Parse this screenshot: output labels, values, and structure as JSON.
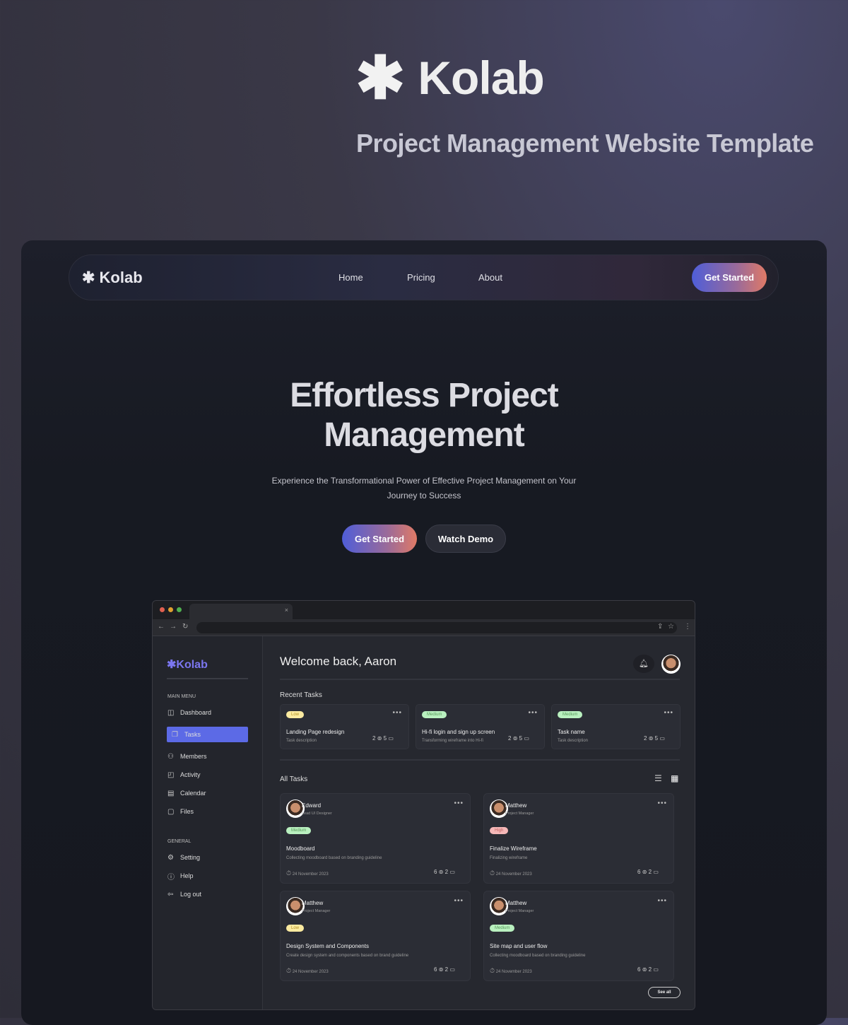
{
  "brand": {
    "name": "Kolab",
    "tagline": "Project Management Website Template"
  },
  "nav": {
    "logo": "Kolab",
    "links": [
      "Home",
      "Pricing",
      "About"
    ],
    "cta": "Get Started"
  },
  "hero": {
    "title_line1": "Effortless Project",
    "title_line2": "Management",
    "subtitle_line1": "Experience the Transformational Power of Effective Project Management on Your",
    "subtitle_line2": "Journey to Success",
    "primary": "Get Started",
    "secondary": "Watch Demo"
  },
  "browser": {
    "tab_close": "×"
  },
  "app": {
    "logo": "Kolab",
    "main_menu_label": "MAIN MENU",
    "main_menu": [
      {
        "label": "Dashboard",
        "icon": "dashboard-icon"
      },
      {
        "label": "Tasks",
        "icon": "tasks-icon",
        "active": true
      },
      {
        "label": "Members",
        "icon": "members-icon"
      },
      {
        "label": "Activity",
        "icon": "activity-icon"
      },
      {
        "label": "Calendar",
        "icon": "calendar-icon"
      },
      {
        "label": "Files",
        "icon": "files-icon"
      }
    ],
    "general_label": "GENERAL",
    "general": [
      {
        "label": "Setting",
        "icon": "gear-icon"
      },
      {
        "label": "Help",
        "icon": "help-icon"
      },
      {
        "label": "Log out",
        "icon": "logout-icon"
      }
    ],
    "welcome": "Welcome back, Aaron",
    "recent_title": "Recent Tasks",
    "recent": [
      {
        "priority": "Low",
        "title": "Landing Page redesign",
        "desc": "Task description",
        "attachments": "2",
        "comments": "5"
      },
      {
        "priority": "Medium",
        "title": "Hi-fi login and sign up screen",
        "desc": "Transforming wireframe into Hi-fi",
        "attachments": "2",
        "comments": "5"
      },
      {
        "priority": "Medium",
        "title": "Task name",
        "desc": "Task description",
        "attachments": "2",
        "comments": "5"
      }
    ],
    "all_title": "All Tasks",
    "all": [
      {
        "name": "Edward",
        "role": "Lead UI Designer",
        "priority": "Medium",
        "title": "Moodboard",
        "desc": "Collecting moodboard based on branding guideline",
        "date": "24 November 2023",
        "attachments": "6",
        "comments": "2"
      },
      {
        "name": "Matthew",
        "role": "Project Manager",
        "priority": "High",
        "title": "Finalize Wireframe",
        "desc": "Finalizing wireframe",
        "date": "24 November 2023",
        "attachments": "6",
        "comments": "2"
      },
      {
        "name": "Matthew",
        "role": "Project Manager",
        "priority": "Low",
        "title": "Design System and Components",
        "desc": "Create design system and components based on brand guideline",
        "date": "24 November 2023",
        "attachments": "6",
        "comments": "2"
      },
      {
        "name": "Matthew",
        "role": "Project Manager",
        "priority": "Medium",
        "title": "Site map and user flow",
        "desc": "Collecting moodboard based on branding guideline",
        "date": "24 November 2023",
        "attachments": "6",
        "comments": "2"
      }
    ],
    "see_all": "See all"
  },
  "colors": {
    "accent": "#5c6ae6",
    "low": "#fbeaa0",
    "medium": "#b9f0bf",
    "high": "#f6b8b8"
  }
}
